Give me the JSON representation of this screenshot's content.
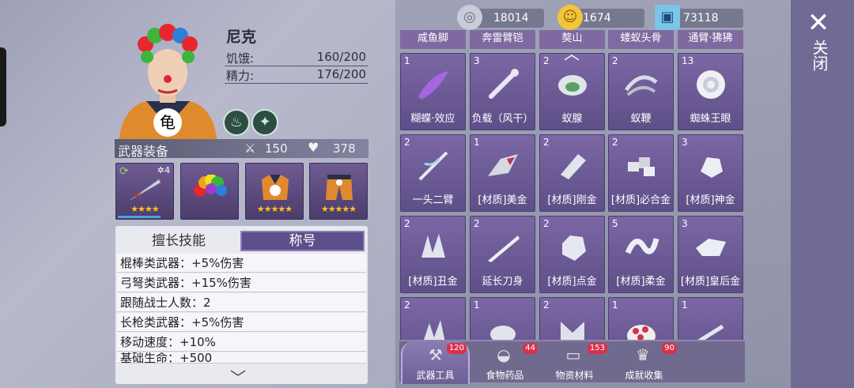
{
  "character": {
    "name": "尼克",
    "hunger_label": "饥饿:",
    "hunger_value": "160/200",
    "energy_label": "精力:",
    "energy_value": "176/200"
  },
  "equipment": {
    "title": "武器装备",
    "attack": "150",
    "health": "378",
    "weapon_level": "4",
    "stars": [
      "★★★★",
      "",
      "★★★★★",
      "★★★★★"
    ]
  },
  "skills": {
    "tab_skill": "擅长技能",
    "tab_title": "称号",
    "rows": [
      "棍棒类武器：+5%伤害",
      "弓弩类武器：+15%伤害",
      "跟随战士人数：2",
      "长枪类武器：+5%伤害",
      "移动速度：+10%",
      "基础生命：+500"
    ]
  },
  "currency": [
    {
      "name": "silver",
      "value": "18014",
      "icon": "coin-stack-icon"
    },
    {
      "name": "gold",
      "value": "1674",
      "icon": "smiley-coin-icon"
    },
    {
      "name": "ticket",
      "value": "73118",
      "icon": "ticket-icon"
    }
  ],
  "grid_headers": [
    "咸鱼脚",
    "奔雷臂铠",
    "獒山",
    "蝼蚁头骨",
    "通臂·狒狒"
  ],
  "items": [
    {
      "count": "1",
      "label": "糊蝶·效应"
    },
    {
      "count": "3",
      "label": "负载（风干）"
    },
    {
      "count": "2",
      "label": "蚁腺"
    },
    {
      "count": "2",
      "label": "蚁鞭"
    },
    {
      "count": "13",
      "label": "蜘蛛王眼"
    },
    {
      "count": "2",
      "label": "一头二臂"
    },
    {
      "count": "1",
      "label": "[材质]美金"
    },
    {
      "count": "2",
      "label": "[材质]刚金"
    },
    {
      "count": "2",
      "label": "[材质]必合金"
    },
    {
      "count": "3",
      "label": "[材质]神金"
    },
    {
      "count": "2",
      "label": "[材质]丑金"
    },
    {
      "count": "2",
      "label": "延长刀身"
    },
    {
      "count": "2",
      "label": "[材质]点金"
    },
    {
      "count": "5",
      "label": "[材质]柔金"
    },
    {
      "count": "3",
      "label": "[材质]皇后金"
    },
    {
      "count": "2",
      "label": ""
    },
    {
      "count": "1",
      "label": ""
    },
    {
      "count": "2",
      "label": ""
    },
    {
      "count": "1",
      "label": ""
    },
    {
      "count": "1",
      "label": ""
    }
  ],
  "bottom_tabs": [
    {
      "label": "武器工具",
      "badge": "120"
    },
    {
      "label": "食物药品",
      "badge": "44"
    },
    {
      "label": "物资材料",
      "badge": "153"
    },
    {
      "label": "成就收集",
      "badge": "90"
    }
  ],
  "close_label": "关闭"
}
